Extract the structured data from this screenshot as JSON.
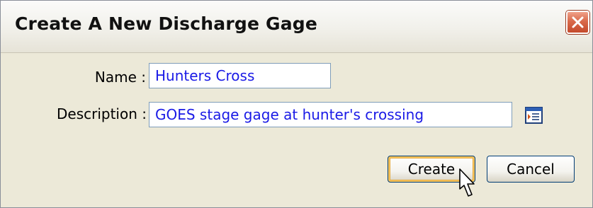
{
  "dialog": {
    "title": "Create A New Discharge Gage"
  },
  "form": {
    "name_label": "Name :",
    "name_value": "Hunters Cross",
    "description_label": "Description :",
    "description_value": "GOES stage gage at hunter's crossing"
  },
  "buttons": {
    "create_label": "Create",
    "cancel_label": "Cancel"
  },
  "icons": {
    "close": "close-icon",
    "browse": "browse-text-icon",
    "cursor": "mouse-pointer-icon"
  },
  "colors": {
    "field_text": "#1a1ae6",
    "close_button": "#d96a4b",
    "default_button_focus": "#f7c65f"
  }
}
